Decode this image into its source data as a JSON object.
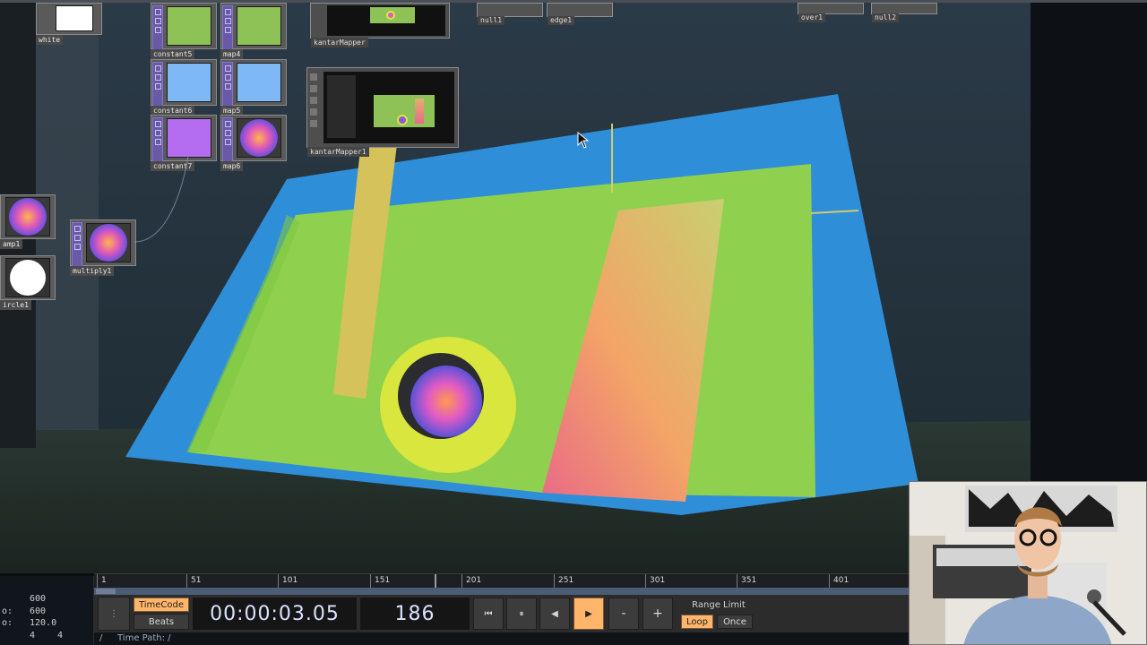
{
  "nodes": {
    "white": "white",
    "constant5": "constant5",
    "map4": "map4",
    "constant6": "constant6",
    "map5": "map5",
    "constant7": "constant7",
    "map6": "map6",
    "ramp1": "amp1",
    "multiply1": "multiply1",
    "circle1": "ircle1",
    "kantarMapper_top": "kantarMapper",
    "kantarMapper1": "kantarMapper1",
    "null1": "null1",
    "edge1": "edge1",
    "over1": "over1",
    "null2": "null2"
  },
  "timeline": {
    "ticks": [
      "1",
      "51",
      "101",
      "151",
      "201",
      "251",
      "301",
      "351",
      "401"
    ],
    "timecode_label": "TimeCode",
    "beats_label": "Beats",
    "timecode": "00:00:03.05",
    "frame": "186",
    "range_limit_label": "Range Limit",
    "loop_label": "Loop",
    "once_label": "Once",
    "minus": "-",
    "plus": "+",
    "time_path": "Time Path: /",
    "path_root": "/"
  },
  "stats": {
    "row1": "600",
    "row2_label": "o:",
    "row2": "600",
    "row3_label": "o:",
    "row3": "120.0",
    "row4a": "4",
    "row4b": "4"
  },
  "colors": {
    "accent": "#ffb56a",
    "projection_green": "#8fd14f",
    "projection_blue": "#2f8ed8",
    "operator_purple": "#6a59a9"
  }
}
